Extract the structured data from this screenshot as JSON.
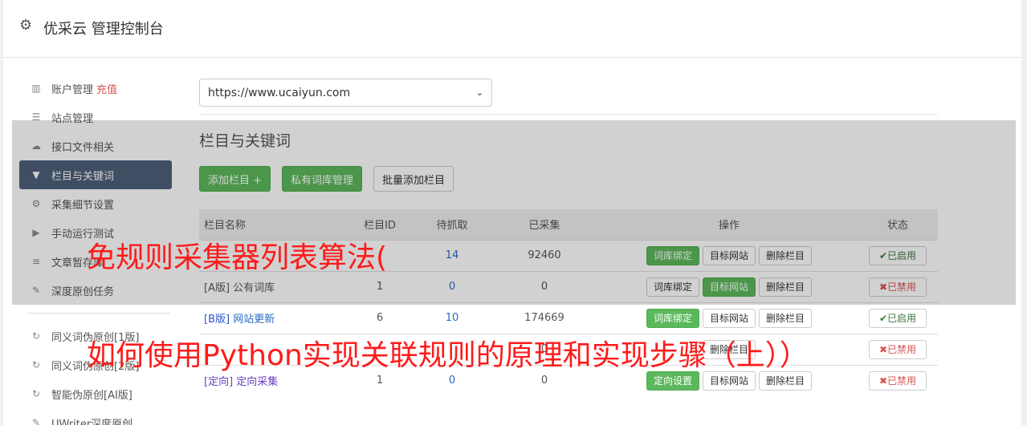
{
  "header": {
    "title": "优采云 管理控制台"
  },
  "sidebar": {
    "items": [
      {
        "label": "账户管理",
        "extra": "充值"
      },
      {
        "label": "站点管理"
      },
      {
        "label": "接口文件相关"
      },
      {
        "label": "栏目与关键词"
      },
      {
        "label": "采集细节设置"
      },
      {
        "label": "手动运行测试"
      },
      {
        "label": "文章暂存库"
      },
      {
        "label": "深度原创任务"
      }
    ],
    "items2": [
      {
        "label": "同义词伪原创[1版]"
      },
      {
        "label": "同义词伪原创[2版]"
      },
      {
        "label": "智能伪原创[AI版]"
      },
      {
        "label": "UWriter深度原创"
      }
    ]
  },
  "main": {
    "site_select": "https://www.ucaiyun.com",
    "section_title": "栏目与关键词",
    "buttons": {
      "add": "添加栏目 +",
      "private": "私有词库管理",
      "batch": "批量添加栏目"
    },
    "table": {
      "headers": [
        "栏目名称",
        "栏目ID",
        "待抓取",
        "已采集",
        "操作",
        "状态"
      ],
      "rows": [
        {
          "tag": "",
          "name": "",
          "id": "",
          "pending": "14",
          "collected": "92460",
          "op1": "词库绑定",
          "op2": "目标网站",
          "op3": "删除栏目",
          "status": "✔已启用"
        },
        {
          "tag": "",
          "name": "[A版] 公有词库",
          "id": "1",
          "pending": "0",
          "collected": "0",
          "op1": "词库绑定",
          "op2": "目标网站",
          "op3": "删除栏目",
          "status": "✖已禁用"
        },
        {
          "tag": "[B版]",
          "name": "网站更新",
          "id": "6",
          "pending": "10",
          "collected": "174669",
          "op1": "词库绑定",
          "op2": "目标网站",
          "op3": "删除栏目",
          "status": "✔已启用"
        },
        {
          "tag": "",
          "name": "",
          "id": "",
          "pending": "",
          "collected": "0",
          "op1": "",
          "op2": "",
          "op3": "删除栏目",
          "status": "✖已禁用"
        },
        {
          "tag": "[定向]",
          "name": "定向采集",
          "id": "1",
          "pending": "0",
          "collected": "0",
          "op1": "定向设置",
          "op2": "目标网站",
          "op3": "删除栏目",
          "status": "✖已禁用"
        }
      ]
    }
  },
  "watermark": {
    "line1": "免规则采集器列表算法(",
    "line2": "如何使用Python实现关联规则的原理和实现步骤（上））"
  }
}
